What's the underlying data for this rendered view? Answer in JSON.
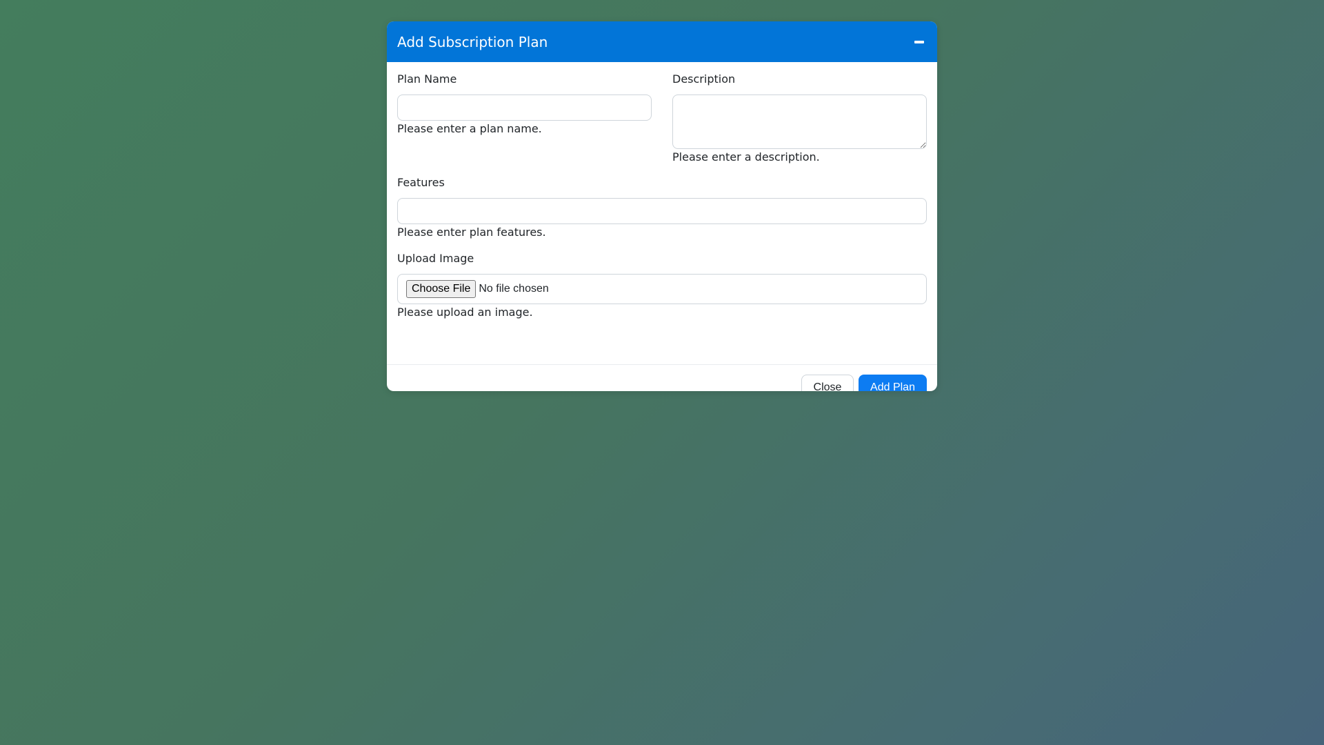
{
  "modal": {
    "title": "Add Subscription Plan"
  },
  "form": {
    "plan_name": {
      "label": "Plan Name",
      "value": "",
      "help": "Please enter a plan name."
    },
    "description": {
      "label": "Description",
      "value": "",
      "help": "Please enter a description."
    },
    "features": {
      "label": "Features",
      "value": "",
      "help": "Please enter plan features."
    },
    "upload_image": {
      "label": "Upload Image",
      "button_label": "Choose File",
      "status": "No file chosen",
      "help": "Please upload an image."
    }
  },
  "footer": {
    "close_label": "Close",
    "submit_label": "Add Plan"
  },
  "colors": {
    "header_bg": "#0275d8",
    "primary_button": "#0d7cf2"
  },
  "icons": {
    "minimize": "minimize-icon"
  }
}
